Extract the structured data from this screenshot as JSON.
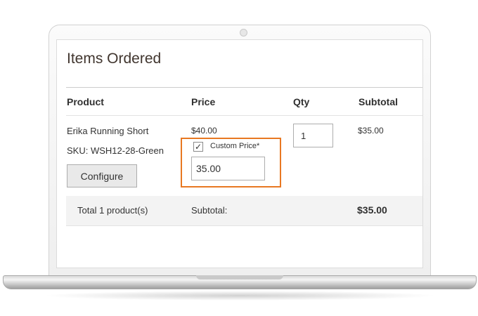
{
  "section": {
    "title": "Items Ordered"
  },
  "columns": [
    "Product",
    "Price",
    "Qty",
    "Subtotal"
  ],
  "item": {
    "name": "Erika Running Short",
    "sku": "SKU: WSH12-28-Green",
    "configure_label": "Configure",
    "original_price": "$40.00",
    "custom_price_checked": true,
    "custom_price_label": "Custom Price*",
    "custom_price_value": "35.00",
    "qty": "1",
    "subtotal": "$35.00"
  },
  "totals": {
    "products_label": "Total 1 product(s)",
    "subtotal_label": "Subtotal:",
    "subtotal_value": "$35.00"
  },
  "colors": {
    "highlight": "#e87822"
  },
  "icons": {
    "checkbox_mark": "checkmark-icon"
  }
}
